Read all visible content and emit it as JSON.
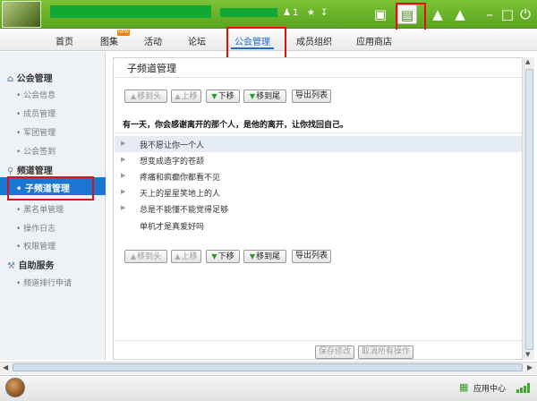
{
  "titlebar": {
    "online_count": "1",
    "icons": [
      "user-icon",
      "star-icon",
      "download-icon",
      "tv-icon",
      "notes-icon",
      "gift-icon",
      "gamepad-icon",
      "minimize-icon",
      "restore-icon",
      "power-icon"
    ]
  },
  "nav": {
    "items": [
      "首页",
      "图集",
      "活动",
      "论坛",
      "公会管理",
      "成员组织",
      "应用商店"
    ],
    "active_index": 4,
    "new_badge": "NEW"
  },
  "sidebar": {
    "sections": [
      {
        "title": "公会管理",
        "icon": "home-icon",
        "items": [
          "公会信息",
          "成员管理",
          "军团管理",
          "公会签到"
        ]
      },
      {
        "title": "频道管理",
        "icon": "pin-icon",
        "items": [
          "子频道管理",
          "黑名单管理",
          "操作日志",
          "权限管理"
        ]
      },
      {
        "title": "自助服务",
        "icon": "wrench-icon",
        "items": [
          "频道排行申请"
        ]
      }
    ],
    "selected": "子频道管理"
  },
  "panel": {
    "title": "子频道管理",
    "toolbar": [
      "移到头",
      "上移",
      "下移",
      "移到尾",
      "导出列表"
    ],
    "message": "有一天，你会感谢离开的那个人，是他的离开，让你找回自己。",
    "channels": [
      {
        "name": "我不愿让你一个人",
        "has_arrow": true,
        "selected": true
      },
      {
        "name": "想变成造字的苍颉",
        "has_arrow": true,
        "selected": false
      },
      {
        "name": "疼痛和疯癫你都看不见",
        "has_arrow": true,
        "selected": false
      },
      {
        "name": "天上的星星笑地上的人",
        "has_arrow": true,
        "selected": false
      },
      {
        "name": "总是不能懂不能觉得足够",
        "has_arrow": true,
        "selected": false
      },
      {
        "name": "单机才是真爱好吗",
        "has_arrow": false,
        "selected": false
      }
    ],
    "save_label": "保存修改",
    "cancel_label": "取消所有操作"
  },
  "bottombar": {
    "app_center": "应用中心"
  },
  "colors": {
    "title_green": "#5aa51f",
    "accent_blue": "#1a76d2",
    "highlight_red": "#e01010"
  }
}
